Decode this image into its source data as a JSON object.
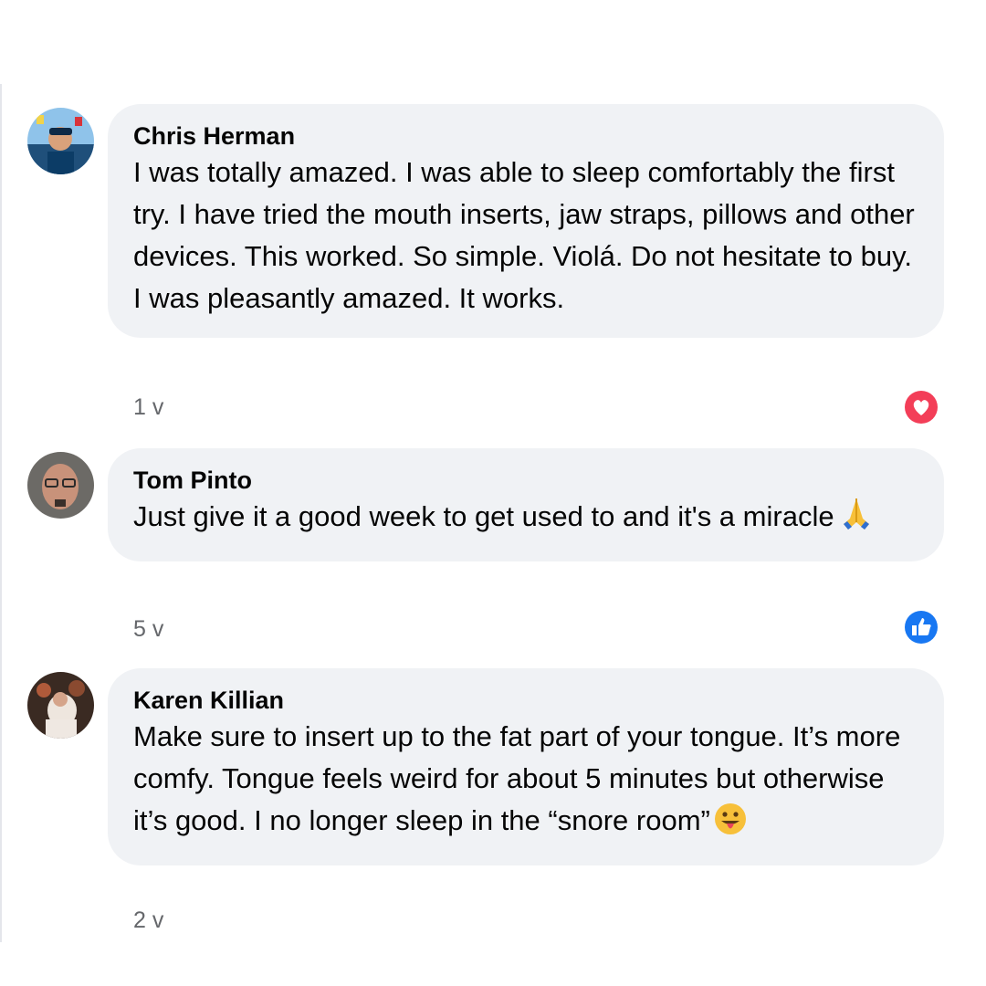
{
  "comments": [
    {
      "author": "Chris Herman",
      "text": "I was totally amazed. I was able to sleep comfortably the first try. I have tried the mouth inserts, jaw straps, pillows and other devices. This worked. So simple. Violá. Do not hesitate to buy. I was pleasantly amazed. It works.",
      "time": "1 v",
      "reaction": "love-reaction-icon",
      "reaction_color": "#f33e58"
    },
    {
      "author": "Tom Pinto",
      "text": "Just give it a good week to get used to and it's a miracle",
      "emoji": "folded-hands-emoji",
      "time": "5 v",
      "reaction": "like-reaction-icon",
      "reaction_color": "#1877f2"
    },
    {
      "author": "Karen Killian",
      "text": "Make sure to insert up to the fat part of your tongue. It’s more comfy. Tongue feels weird for about 5 minutes but otherwise it’s good. I no longer sleep in the “snore room”",
      "emoji": "tongue-out-emoji",
      "time": "2 v"
    }
  ]
}
